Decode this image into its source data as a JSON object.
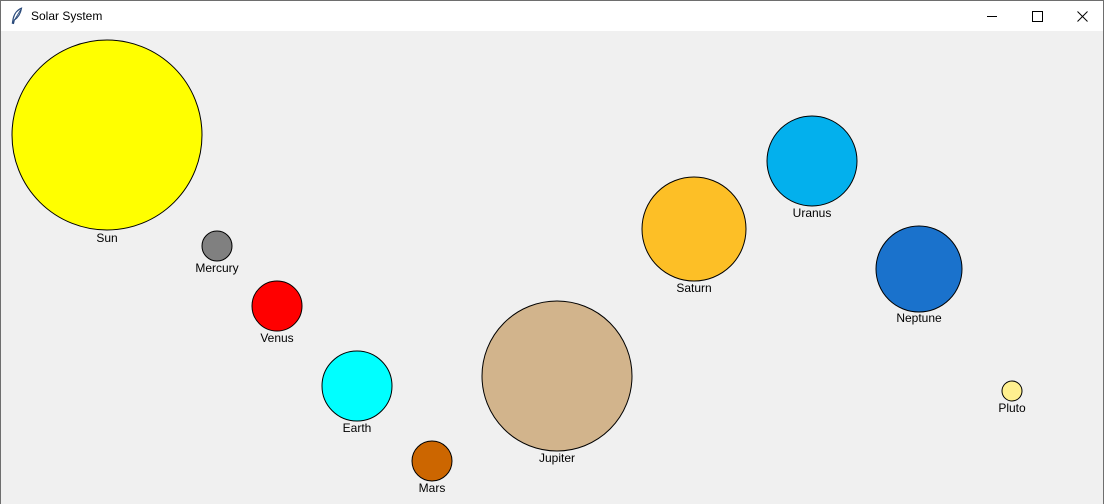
{
  "window": {
    "title": "Solar System",
    "minimize_icon": "minimize-icon",
    "maximize_icon": "maximize-icon",
    "close_icon": "close-icon",
    "app_icon": "feather-icon"
  },
  "bodies": [
    {
      "name": "Sun",
      "color": "#ffff00"
    },
    {
      "name": "Mercury",
      "color": "#808080"
    },
    {
      "name": "Venus",
      "color": "#ff0000"
    },
    {
      "name": "Earth",
      "color": "#00ffff"
    },
    {
      "name": "Mars",
      "color": "#cc6600"
    },
    {
      "name": "Jupiter",
      "color": "#d2b48c"
    },
    {
      "name": "Saturn",
      "color": "#fdbf26"
    },
    {
      "name": "Uranus",
      "color": "#03b0ed"
    },
    {
      "name": "Neptune",
      "color": "#1a72cc"
    },
    {
      "name": "Pluto",
      "color": "#fff08f"
    }
  ]
}
